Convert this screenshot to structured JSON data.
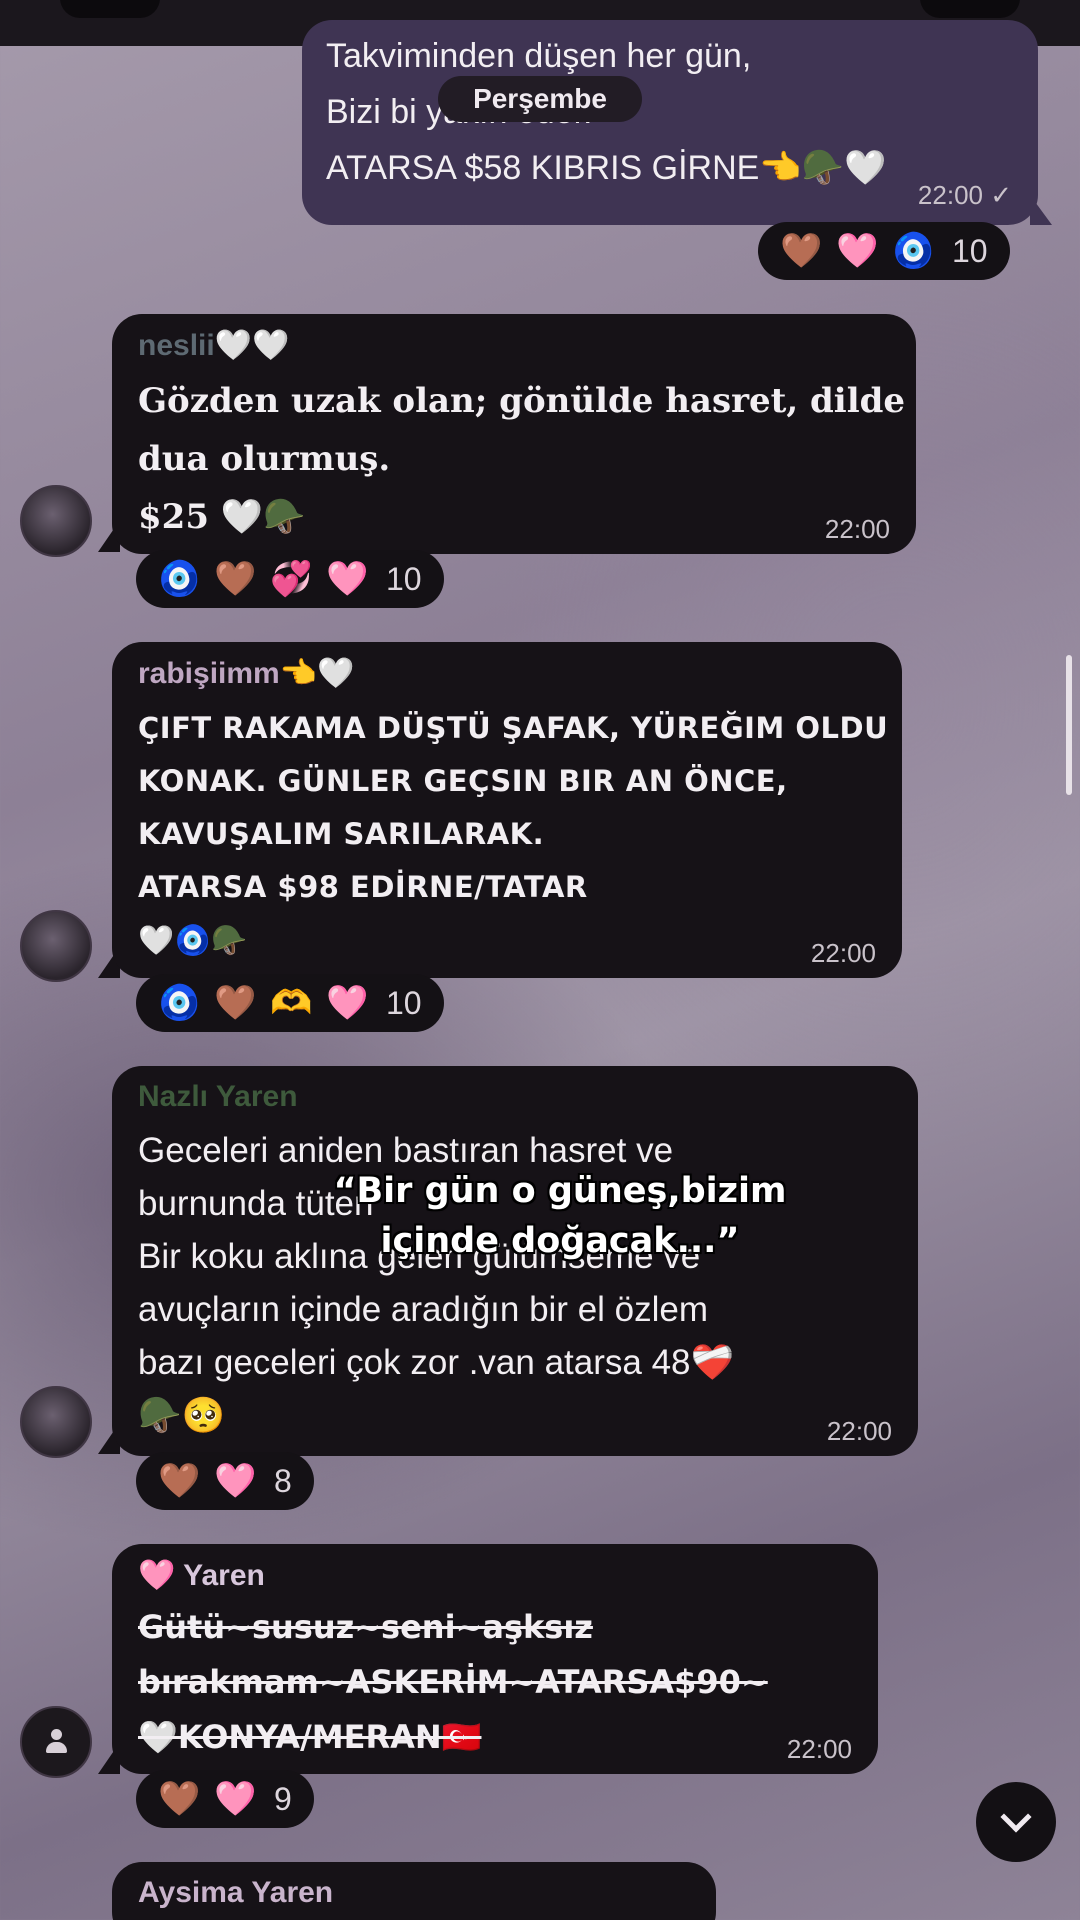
{
  "date_separator": "Perşembe",
  "overlay_caption": "“Bir gün o güneş,bizim içinde doğacak...”",
  "messages": [
    {
      "type": "outgoing",
      "partial_text": "Takviminden düşen her gün,\nBizi bi   yakın eder.\nATARSA $58 KIBRIS GİRNE👈🪖🤍",
      "time": "22:00 ✓",
      "reactions": {
        "emojis": [
          "🤎",
          "🩷",
          "🧿"
        ],
        "count": "10"
      }
    },
    {
      "type": "incoming",
      "sender": "neslii🤍🤍",
      "sender_color": "#5e6a73",
      "text": "Gözden uzak olan; gönülde hasret, dilde\ndua olurmuş.\n$25 🤍🪖",
      "time": "22:00",
      "reactions": {
        "emojis": [
          "🧿",
          "🤎",
          "💞",
          "🩷"
        ],
        "count": "10"
      }
    },
    {
      "type": "incoming",
      "sender": "rabişiimm👈🤍",
      "sender_color": "#bfa7c2",
      "text": "ÇIFT RAKAMA DÜŞTÜ ŞAFAK, YÜREĞIM OLDU\nKONAK. GÜNLER GEÇSIN BIR AN ÖNCE,\nKAVUŞALIM SARILARAK.\nATARSA $98 EDİRNE/TATAR\n🤍🧿🪖",
      "time": "22:00",
      "reactions": {
        "emojis": [
          "🧿",
          "🤎",
          "🫶",
          "🩷"
        ],
        "count": "10"
      }
    },
    {
      "type": "incoming",
      "sender": "Nazlı Yaren",
      "sender_color": "#3e5a3c",
      "text": "Geceleri aniden bastıran hasret ve\nburnunda tüten\nBir koku aklına gelen gülümseme ve\navuçların içinde aradığın bir el  özlem\nbazı geceleri  çok zor  .van  atarsa 48❤️‍🩹\n🪖🥺",
      "time": "22:00",
      "reactions": {
        "emojis": [
          "🤎",
          "🩷"
        ],
        "count": "8"
      }
    },
    {
      "type": "incoming",
      "sender": "🩷 Yaren",
      "sender_color": "#d8c7dc",
      "text": "Gütü~susuz~seni~aşksız\nbırakmam~ASKERİM~ATARSA$90~\n🤍KONYA/MERAN🇹🇷",
      "time": "22:00",
      "reactions": {
        "emojis": [
          "🤎",
          "🩷"
        ],
        "count": "9"
      }
    },
    {
      "type": "incoming",
      "sender": "Aysima Yaren",
      "sender_color": "#c9b4cc"
    }
  ],
  "icons": {
    "scroll_down": "chevron-down-icon",
    "default_avatar": "person-icon"
  }
}
